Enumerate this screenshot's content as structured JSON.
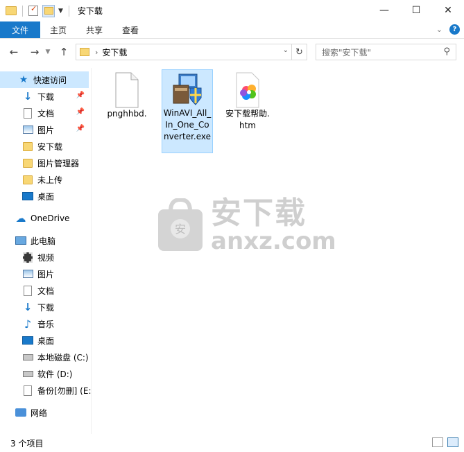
{
  "window": {
    "title": "安下载",
    "controls": {
      "minimize": "—",
      "maximize": "☐",
      "close": "✕"
    }
  },
  "ribbon": {
    "file_tab": "文件",
    "tabs": [
      "主页",
      "共享",
      "查看"
    ],
    "help": "?"
  },
  "address": {
    "path": "安下载",
    "search_placeholder": "搜索\"安下载\""
  },
  "nav": {
    "quick_access": "快速访问",
    "quick_items": [
      {
        "label": "下载",
        "icon": "download-arrow-icon",
        "pinned": true
      },
      {
        "label": "文档",
        "icon": "document-icon",
        "pinned": true
      },
      {
        "label": "图片",
        "icon": "pictures-icon",
        "pinned": true
      },
      {
        "label": "安下载",
        "icon": "folder-icon",
        "pinned": false
      },
      {
        "label": "图片管理器",
        "icon": "folder-icon",
        "pinned": false
      },
      {
        "label": "未上传",
        "icon": "folder-icon",
        "pinned": false
      },
      {
        "label": "桌面",
        "icon": "desktop-icon",
        "pinned": false
      }
    ],
    "onedrive": "OneDrive",
    "this_pc": "此电脑",
    "pc_items": [
      {
        "label": "视频",
        "icon": "video-icon"
      },
      {
        "label": "图片",
        "icon": "pictures-icon"
      },
      {
        "label": "文档",
        "icon": "document-icon"
      },
      {
        "label": "下载",
        "icon": "download-arrow-icon"
      },
      {
        "label": "音乐",
        "icon": "music-note-icon"
      },
      {
        "label": "桌面",
        "icon": "desktop-icon"
      },
      {
        "label": "本地磁盘 (C:)",
        "icon": "local-disk-icon"
      },
      {
        "label": "软件 (D:)",
        "icon": "drive-icon"
      },
      {
        "label": "备份[勿删] (E:",
        "icon": "blank-file-icon"
      }
    ],
    "network": "网络"
  },
  "files": [
    {
      "name": "pnghhbd.",
      "icon": "blank-file-icon",
      "selected": false
    },
    {
      "name": "WinAVI_All_In_One_Converter.exe",
      "icon": "installer-icon",
      "selected": true
    },
    {
      "name": "安下载帮助.htm",
      "icon": "htm-pinwheel-icon",
      "selected": false
    }
  ],
  "watermark": {
    "cn": "安下载",
    "en": "anxz.com",
    "badge": "安"
  },
  "status": {
    "count": "3 个项目"
  },
  "colors": {
    "accent": "#1979ca",
    "selection": "#cce8ff",
    "folder": "#f8d775"
  }
}
